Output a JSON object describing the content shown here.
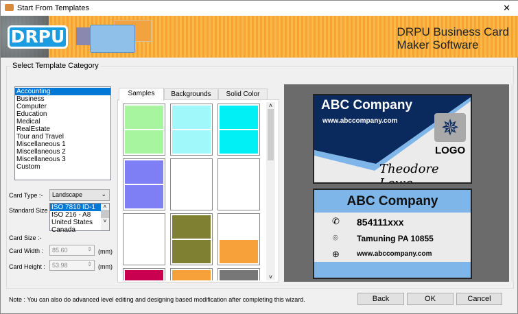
{
  "window": {
    "title": "Start From Templates",
    "close": "✕"
  },
  "banner": {
    "logo": "DRPU",
    "brand_line1": "DRPU Business Card",
    "brand_line2": "Maker Software"
  },
  "group_title": "Select Template Category",
  "categories": [
    "Accounting",
    "Business",
    "Computer",
    "Education",
    "Medical",
    "RealEstate",
    "Tour and Travel",
    "Miscellaneous 1",
    "Miscellaneous 2",
    "Miscellaneous 3",
    "Custom"
  ],
  "selected_category": "Accounting",
  "card_type": {
    "label": "Card Type :-",
    "value": "Landscape"
  },
  "standard_size": {
    "label": "Standard Size :-",
    "options": [
      "ISO 7810 ID-1",
      "ISO 216 - A8",
      "United States",
      "Canada"
    ]
  },
  "card_size_label": "Card Size :-",
  "card_width": {
    "label": "Card Width :",
    "value": "85.60",
    "unit": "(mm)"
  },
  "card_height": {
    "label": "Card Height :",
    "value": "53.98",
    "unit": "(mm)"
  },
  "tabs": [
    "Samples",
    "Backgrounds",
    "Solid Color"
  ],
  "thumbnails": [
    {
      "a": "#a8f5a0",
      "b": "#a8f5a0"
    },
    {
      "a": "#a0f8fb",
      "b": "#a0f8fb"
    },
    {
      "a": "#00f0f5",
      "b": "#00f0f5"
    },
    {
      "a": "#7f7ff5",
      "b": "#7f7ff5"
    },
    {
      "a": "#ffffff",
      "b": "#ffffff"
    },
    {
      "a": "#ffffff",
      "b": "#ffffff"
    },
    {
      "a": "#ffffff",
      "b": "#ffffff"
    },
    {
      "a": "#808033",
      "b": "#808033"
    },
    {
      "a": "#ffffff",
      "b": "#f7a13a"
    },
    {
      "a": "#c8004f",
      "b": "#c8004f"
    },
    {
      "a": "#f7a13a",
      "b": "#666666"
    },
    {
      "a": "#777777",
      "b": "#777777"
    }
  ],
  "preview": {
    "front": {
      "company": "ABC Company",
      "website": "www.abccompany.com",
      "logo": "LOGO",
      "name": "Theodore Lowe"
    },
    "back": {
      "company": "ABC Company",
      "phone": "854111xxx",
      "address": "Tamuning PA 10855",
      "website": "www.abccompany.com"
    }
  },
  "note": "Note : You can also do advanced level editing and designing based modification after completing this wizard.",
  "buttons": {
    "back": "Back",
    "ok": "OK",
    "cancel": "Cancel"
  },
  "colors": {
    "navy": "#0a2a5e",
    "light_blue": "#7fb6ea",
    "preview_bg": "#6b6b6b"
  }
}
